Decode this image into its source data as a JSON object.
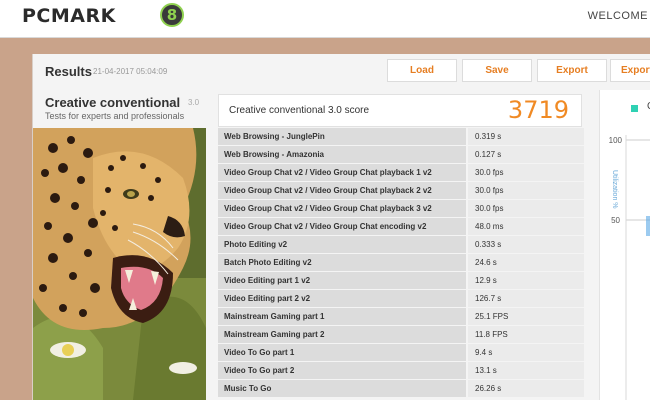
{
  "header": {
    "logo_text": "PCMARK",
    "logo_badge": "8",
    "welcome": "WELCOME"
  },
  "results": {
    "title": "Results",
    "date": "21-04-2017 05:04:09"
  },
  "toolbar": {
    "load": "Load",
    "save": "Save",
    "export": "Export",
    "export2": "Export"
  },
  "test": {
    "name": "Creative conventional",
    "version": "3.0",
    "subtitle": "Tests for experts and professionals"
  },
  "score": {
    "label": "Creative conventional 3.0 score",
    "value": "3719"
  },
  "rows": [
    {
      "name": "Web Browsing - JunglePin",
      "value": "0.319 s"
    },
    {
      "name": "Web Browsing - Amazonia",
      "value": "0.127 s"
    },
    {
      "name": "Video Group Chat v2 / Video Group Chat playback 1 v2",
      "value": "30.0 fps"
    },
    {
      "name": "Video Group Chat v2 / Video Group Chat playback 2 v2",
      "value": "30.0 fps"
    },
    {
      "name": "Video Group Chat v2 / Video Group Chat playback 3 v2",
      "value": "30.0 fps"
    },
    {
      "name": "Video Group Chat v2 / Video Group Chat encoding v2",
      "value": "48.0 ms"
    },
    {
      "name": "Photo Editing v2",
      "value": "0.333 s"
    },
    {
      "name": "Batch Photo Editing v2",
      "value": "24.6 s"
    },
    {
      "name": "Video Editing part 1 v2",
      "value": "12.9 s"
    },
    {
      "name": "Video Editing part 2 v2",
      "value": "126.7 s"
    },
    {
      "name": "Mainstream Gaming part 1",
      "value": "25.1 FPS"
    },
    {
      "name": "Mainstream Gaming part 2",
      "value": "11.8 FPS"
    },
    {
      "name": "Video To Go part 1",
      "value": "9.4 s"
    },
    {
      "name": "Video To Go part 2",
      "value": "13.1 s"
    },
    {
      "name": "Music To Go",
      "value": "26.26 s"
    }
  ],
  "side_chart": {
    "legend": "C",
    "tick_100": "100",
    "tick_50": "50",
    "axis_label": "Utilization %"
  },
  "colors": {
    "accent": "#f08a24",
    "legend": "#2fd1b3",
    "logo_badge": "#8fd14f"
  },
  "icons": {
    "hero": "leopard-photo"
  }
}
